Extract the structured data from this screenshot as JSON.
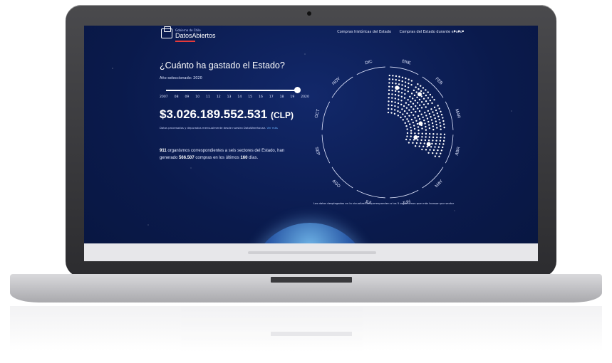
{
  "header": {
    "logo_small": "Gobierno de Chile",
    "logo_text": "DatosAbiertos",
    "nav": [
      "Compras históricas del Estado",
      "Compras del Estado durante el año"
    ],
    "more": "•••"
  },
  "main": {
    "title": "¿Cuánto ha gastado el Estado?",
    "year_label": "Año seleccionado: 2020",
    "slider": {
      "ticks": [
        "2007",
        "08",
        "09",
        "10",
        "11",
        "12",
        "13",
        "14",
        "15",
        "16",
        "17",
        "18",
        "19",
        "2020"
      ],
      "value_fraction": 1.0
    },
    "amount": "$3.026.189.552.531",
    "currency": "(CLP)",
    "source": "Datos procesados y depurados mensualmente desde nuestro DataWarehouse.",
    "source_link": "Ver más",
    "para": {
      "n1": "911",
      "t1": " organismos correspondientes a seis sectores del Estado, han generado ",
      "n2": "566.507",
      "t2": " compras en los últimos ",
      "n3": "160",
      "t3": " días."
    }
  },
  "wheel": {
    "months": [
      "ENE",
      "FEB",
      "MAR",
      "ABR",
      "MAY",
      "JUN",
      "JUL",
      "AGO",
      "SEP",
      "OCT",
      "NOV",
      "DIC"
    ],
    "filled_months": 4,
    "caption": "Los datos desplegados en la visualización corresponden a los 5 organismos que más transan por sector"
  },
  "colors": {
    "background": "#0a1a4c",
    "accent": "#e53a3a",
    "link": "#6fb4ff"
  }
}
